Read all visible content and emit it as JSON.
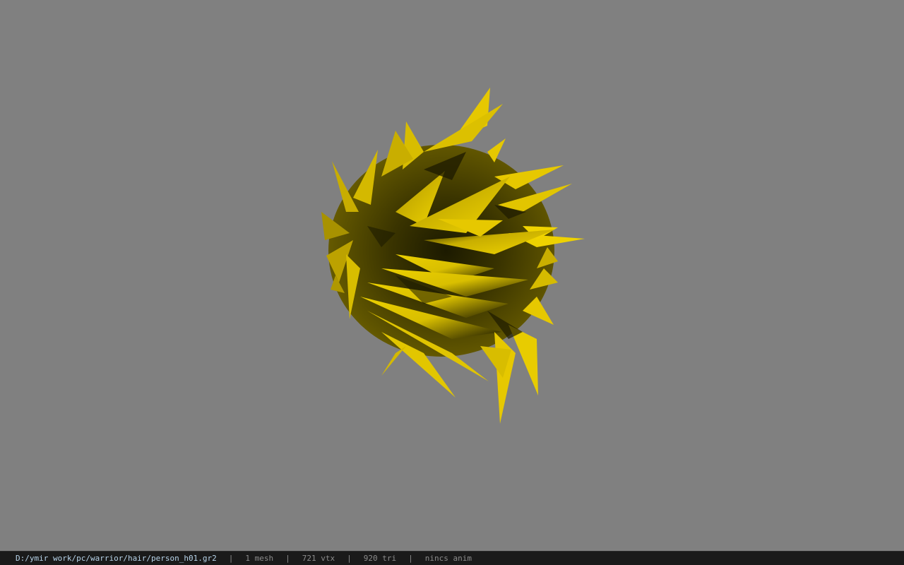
{
  "status_bar": {
    "file_path": "D:/ymir work/pc/warrior/hair/person_h01.gr2",
    "separator": "|",
    "mesh_count": "1 mesh",
    "vertex_count": "721 vtx",
    "triangle_count": "920 tri",
    "anim_status": "nincs anim"
  },
  "viewport": {
    "background_color": "#808080",
    "model_color": "#e6c800",
    "model_shadow_color": "#1c1a00"
  }
}
